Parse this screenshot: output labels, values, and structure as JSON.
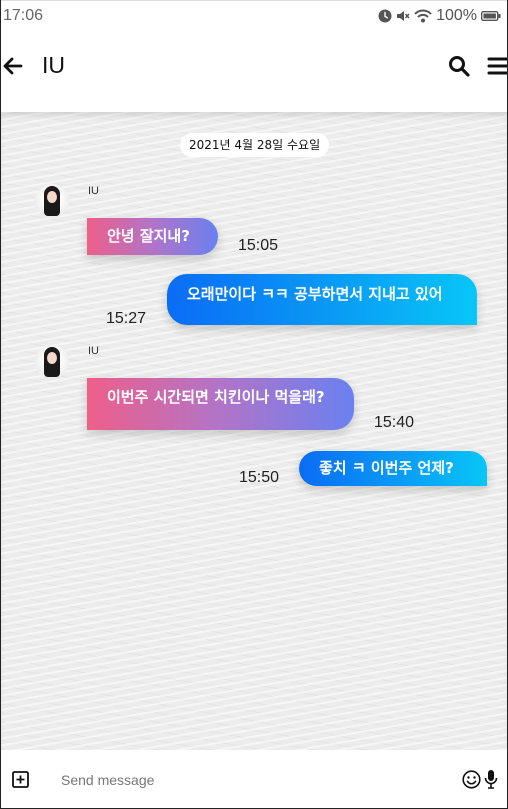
{
  "status_bar": {
    "time": "17:06",
    "battery": "100%",
    "icons": [
      "alarm-icon",
      "mute-icon",
      "wifi-icon",
      "battery-icon"
    ]
  },
  "header": {
    "contact_name": "IU",
    "icons": [
      "back-arrow-icon",
      "search-icon",
      "menu-icon"
    ]
  },
  "chat": {
    "date_label": "2021년 4월 28일 수요일",
    "messages": [
      {
        "direction": "received",
        "sender": "IU",
        "text": "안녕 잘지내?",
        "time": "15:05"
      },
      {
        "direction": "sent",
        "text": "오래만이다 ㅋㅋ 공부하면서 지내고 있어",
        "time": "15:27"
      },
      {
        "direction": "received",
        "sender": "IU",
        "text": "이번주 시간되면 치킨이나 먹을래?",
        "time": "15:40"
      },
      {
        "direction": "sent",
        "text": "좋치 ㅋ 이번주 언제?",
        "time": "15:50"
      }
    ]
  },
  "input_bar": {
    "placeholder": "Send message",
    "icons": [
      "add-attachment-icon",
      "emoji-icon",
      "microphone-icon"
    ]
  },
  "colors": {
    "received_gradient": [
      "#ee5f8a",
      "#6a80f0"
    ],
    "sent_gradient": [
      "#0a6cf5",
      "#08c6f7"
    ]
  }
}
